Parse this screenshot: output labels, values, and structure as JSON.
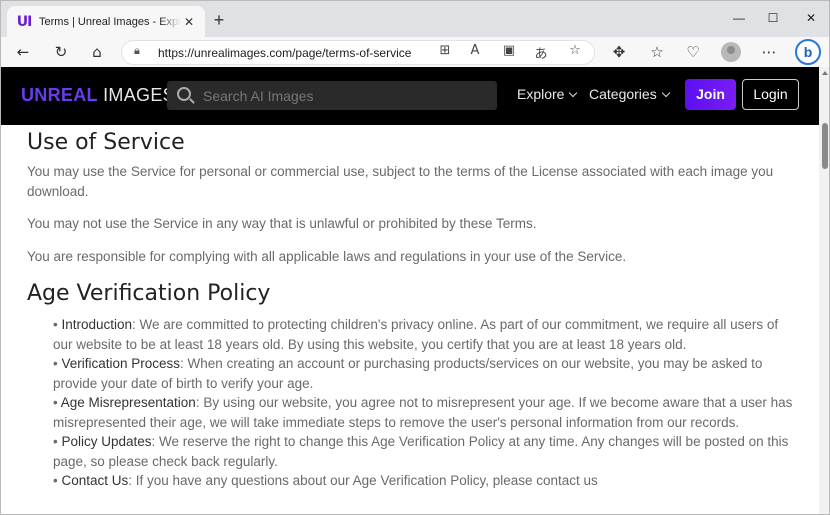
{
  "browser": {
    "tab_title": "Terms | Unreal Images - Explore an",
    "favicon_text": "UI",
    "close_glyph": "✕",
    "new_tab_glyph": "+",
    "url": "https://unrealimages.com/page/terms-of-service",
    "bing_label": "b"
  },
  "site": {
    "logo_part1": "UNREAL",
    "logo_part2": " IMAGES",
    "search_placeholder": "Search AI Images",
    "nav_explore": "Explore",
    "nav_categories": "Categories",
    "join_label": "Join",
    "login_label": "Login"
  },
  "sections": {
    "use_title": "Use of Service",
    "use_p1": "You may use the Service for personal or commercial use, subject to the terms of the License associated with each image you download.",
    "use_p2": "You may not use the Service in any way that is unlawful or prohibited by these Terms.",
    "use_p3": "You are responsible for complying with all applicable laws and regulations in your use of the Service.",
    "age_title": "Age Verification Policy",
    "bullets": [
      {
        "label": "Introduction",
        "text": ": We are committed to protecting children's privacy online. As part of our commitment, we require all users of our website to be at least 18 years old. By using this website, you certify that you are at least 18 years old."
      },
      {
        "label": "Verification Process",
        "text": ": When creating an account or purchasing products/services on our website, you may be asked to provide your date of birth to verify your age."
      },
      {
        "label": "Age Misrepresentation",
        "text": ": By using our website, you agree not to misrepresent your age. If we become aware that a user has misrepresented their age, we will take immediate steps to remove the user's personal information from our records."
      },
      {
        "label": "Policy Updates",
        "text": ": We reserve the right to change this Age Verification Policy at any time. Any changes will be posted on this page, so please check back regularly."
      },
      {
        "label": "Contact Us",
        "text": ": If you have any questions about our Age Verification Policy, please contact us"
      }
    ]
  }
}
